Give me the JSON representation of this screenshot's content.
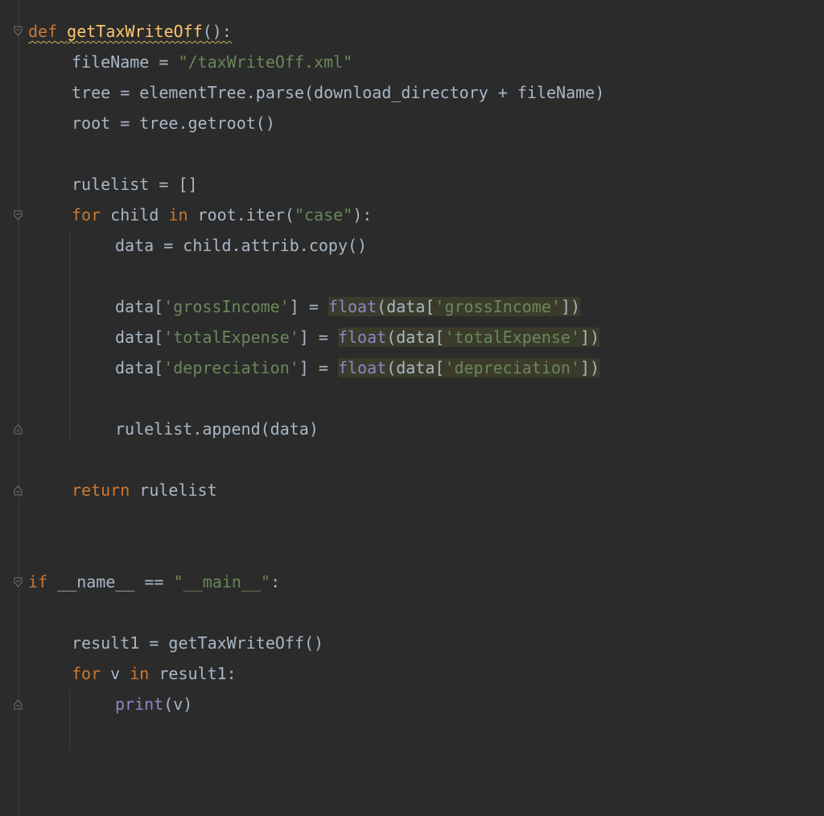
{
  "colors": {
    "background": "#2b2b2b",
    "keyword": "#cc7832",
    "function_name": "#ffc66d",
    "string": "#6a8759",
    "builtin": "#8888c6",
    "default_text": "#a9b7c6",
    "highlight": "#3b3b2c"
  },
  "code": {
    "line1": {
      "kw": "def",
      "fn": "getTaxWriteOff",
      "rest": "():"
    },
    "line2": {
      "pre": "fileName = ",
      "str": "\"/taxWriteOff.xml\""
    },
    "line3": {
      "text": "tree = elementTree.parse(download_directory + fileName)"
    },
    "line4": {
      "text": "root = tree.getroot()"
    },
    "line6": {
      "text": "rulelist = []"
    },
    "line7": {
      "kw1": "for",
      "mid1": " child ",
      "kw2": "in",
      "mid2": " root.iter(",
      "str": "\"case\"",
      "end": "):"
    },
    "line8": {
      "text": "data = child.attrib.copy()"
    },
    "line10": {
      "pre": "data[",
      "str1": "'grossIncome'",
      "mid": "] = ",
      "bi": "float",
      "hl_pre": "(data[",
      "str2": "'grossIncome'",
      "end": "])"
    },
    "line11": {
      "pre": "data[",
      "str1": "'totalExpense'",
      "mid": "] = ",
      "bi": "float",
      "hl_pre": "(data[",
      "str2": "'totalExpense'",
      "end": "])"
    },
    "line12": {
      "pre": "data[",
      "str1": "'depreciation'",
      "mid": "] = ",
      "bi": "float",
      "hl_pre": "(data[",
      "str2": "'depreciation'",
      "end": "])"
    },
    "line14": {
      "text": "rulelist.append(data)"
    },
    "line16": {
      "kw": "return",
      "rest": " rulelist"
    },
    "line19": {
      "kw": "if",
      "pre": " __name__ == ",
      "str": "\"__main__\"",
      "end": ":"
    },
    "line21": {
      "text": "result1 = getTaxWriteOff()"
    },
    "line22": {
      "kw1": "for",
      "mid": " v ",
      "kw2": "in",
      "end": " result1:"
    },
    "line23": {
      "bi": "print",
      "end": "(v)"
    }
  }
}
